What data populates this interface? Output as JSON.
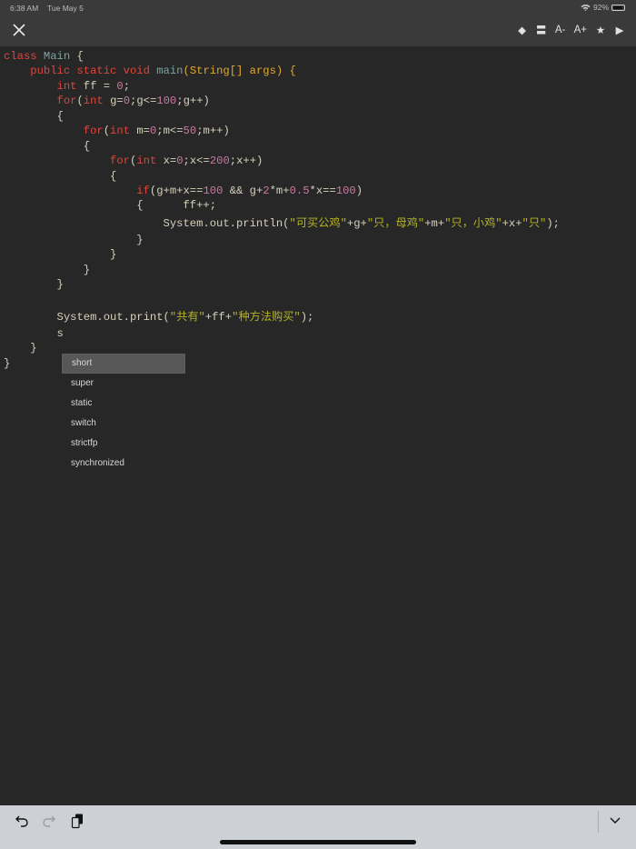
{
  "status_bar": {
    "time": "6:38 AM",
    "date": "Tue May 5",
    "battery": "92%",
    "battery_level": 0.92
  },
  "toolbar": {
    "close_icon": "close-icon",
    "buttons": [
      {
        "name": "diamond",
        "label": "◆"
      },
      {
        "name": "equals",
        "label": "〓"
      },
      {
        "name": "font-decrease",
        "label": "A-"
      },
      {
        "name": "font-increase",
        "label": "A+"
      },
      {
        "name": "star",
        "label": "★"
      },
      {
        "name": "run",
        "label": "▶"
      }
    ]
  },
  "code_lines": [
    {
      "top": 0,
      "tokens": [
        [
          "kw",
          "class "
        ],
        [
          "cls",
          "Main"
        ],
        [
          "pl",
          " {"
        ]
      ]
    },
    {
      "tokens": [
        [
          "pl",
          "    "
        ],
        [
          "kw",
          "public static void "
        ],
        [
          "fn",
          "main"
        ],
        [
          "ar",
          "(String[] args) {"
        ]
      ]
    },
    {
      "tokens": [
        [
          "pl",
          "        "
        ],
        [
          "kw",
          "int "
        ],
        [
          "pl",
          "ff = "
        ],
        [
          "num",
          "0"
        ],
        [
          "pl",
          ";"
        ]
      ]
    },
    {
      "tokens": [
        [
          "pl",
          "        "
        ],
        [
          "kw",
          "for"
        ],
        [
          "pl",
          "("
        ],
        [
          "kw",
          "int "
        ],
        [
          "pl",
          "g="
        ],
        [
          "num",
          "0"
        ],
        [
          "pl",
          ";g<="
        ],
        [
          "num",
          "100"
        ],
        [
          "pl",
          ";g++)"
        ]
      ]
    },
    {
      "tokens": [
        [
          "pl",
          "        {"
        ]
      ]
    },
    {
      "tokens": [
        [
          "pl",
          "            "
        ],
        [
          "kw",
          "for"
        ],
        [
          "pl",
          "("
        ],
        [
          "kw",
          "int "
        ],
        [
          "pl",
          "m="
        ],
        [
          "num",
          "0"
        ],
        [
          "pl",
          ";m<="
        ],
        [
          "num",
          "50"
        ],
        [
          "pl",
          ";m++)"
        ]
      ]
    },
    {
      "tokens": [
        [
          "pl",
          "            {"
        ]
      ]
    },
    {
      "tokens": [
        [
          "pl",
          "                "
        ],
        [
          "kw",
          "for"
        ],
        [
          "pl",
          "("
        ],
        [
          "kw",
          "int "
        ],
        [
          "pl",
          "x="
        ],
        [
          "num",
          "0"
        ],
        [
          "pl",
          ";x<="
        ],
        [
          "num",
          "200"
        ],
        [
          "pl",
          ";x++)"
        ]
      ]
    },
    {
      "tokens": [
        [
          "pl",
          "                {"
        ]
      ]
    },
    {
      "tokens": [
        [
          "pl",
          "                    "
        ],
        [
          "kw",
          "if"
        ],
        [
          "pl",
          "(g+m+x=="
        ],
        [
          "num",
          "100"
        ],
        [
          "pl",
          " && g+"
        ],
        [
          "num",
          "2"
        ],
        [
          "pl",
          "*m+"
        ],
        [
          "num",
          "0.5"
        ],
        [
          "pl",
          "*x=="
        ],
        [
          "num",
          "100"
        ],
        [
          "pl",
          ")"
        ]
      ]
    },
    {
      "tokens": [
        [
          "pl",
          "                    {      ff++;"
        ]
      ]
    },
    {
      "tokens": [
        [
          "pl",
          "                        System.out.println("
        ],
        [
          "str",
          "\"可买公鸡\""
        ],
        [
          "pl",
          "+g+"
        ],
        [
          "str",
          "\"只，母鸡\""
        ],
        [
          "pl",
          "+m+"
        ],
        [
          "str",
          "\"只，小鸡\""
        ],
        [
          "pl",
          "+x+"
        ],
        [
          "str",
          "\"只\""
        ],
        [
          "pl",
          ");"
        ]
      ]
    },
    {
      "tokens": [
        [
          "pl",
          "                    }"
        ]
      ]
    },
    {
      "tokens": [
        [
          "pl",
          "                }"
        ]
      ]
    },
    {
      "tokens": [
        [
          "pl",
          "            }"
        ]
      ]
    },
    {
      "tokens": [
        [
          "pl",
          "        }"
        ]
      ]
    },
    {
      "tokens": [
        [
          "pl",
          ""
        ]
      ]
    },
    {
      "tokens": [
        [
          "pl",
          "        System.out.print("
        ],
        [
          "str",
          "\"共有\""
        ],
        [
          "pl",
          "+ff+"
        ],
        [
          "str",
          "\"种方法购买\""
        ],
        [
          "pl",
          ");"
        ]
      ]
    },
    {
      "tokens": [
        [
          "pl",
          "        s"
        ]
      ]
    },
    {
      "tokens": [
        [
          "pl",
          "    }"
        ]
      ]
    },
    {
      "tokens": [
        [
          "pl",
          "}"
        ]
      ]
    }
  ],
  "autocomplete": {
    "selected": 0,
    "items": [
      "short",
      "super",
      "static",
      "switch",
      "strictfp",
      "synchronized"
    ]
  },
  "bottom_bar": {
    "icons": [
      "undo-icon",
      "redo-icon",
      "paste-icon",
      "chevron-down-icon"
    ]
  },
  "colors": {
    "background": "#272727",
    "keyword": "#e0453b",
    "number": "#c97aa2",
    "string": "#b5b226",
    "plain": "#d6d0bd",
    "type": "#7fa39d"
  }
}
